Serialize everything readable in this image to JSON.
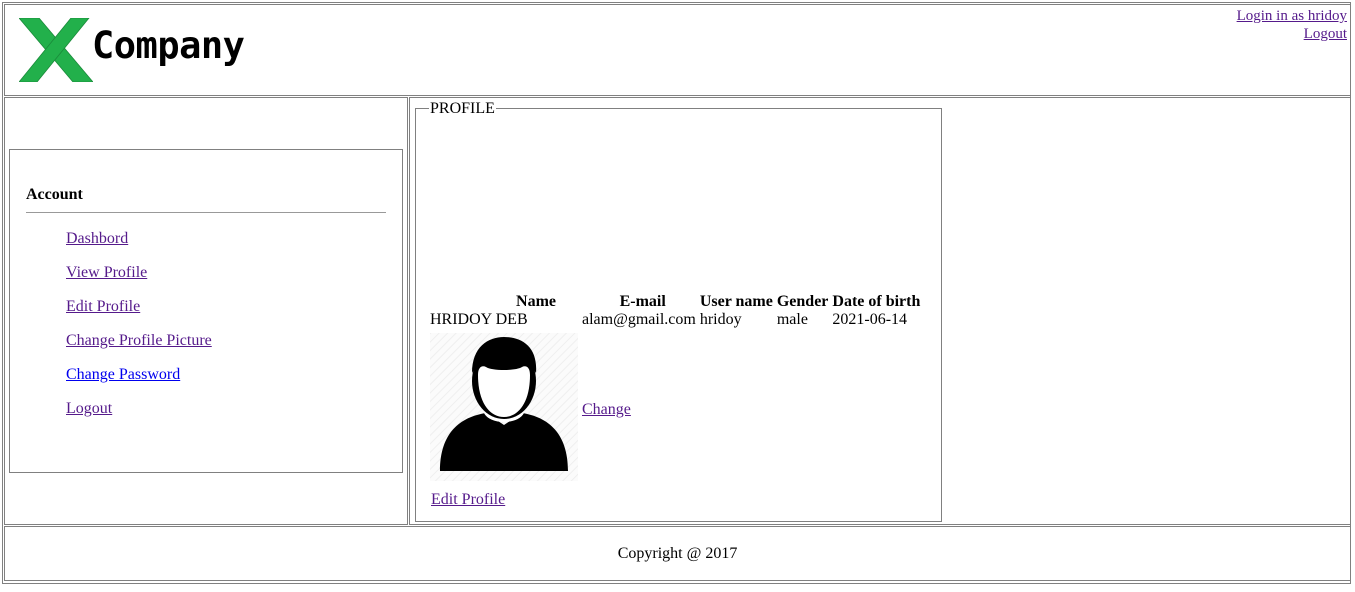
{
  "header": {
    "brand": "Company",
    "logo_icon": "x-logo-icon",
    "logo_color": "#22b04b",
    "login_status": "Login in as hridoy",
    "logout": "Logout"
  },
  "sidebar": {
    "title": "Account",
    "items": [
      {
        "label": "Dashbord"
      },
      {
        "label": "View Profile"
      },
      {
        "label": "Edit Profile"
      },
      {
        "label": "Change Profile Picture"
      },
      {
        "label": "Change Password"
      },
      {
        "label": "Logout"
      }
    ]
  },
  "profile": {
    "legend": "PROFILE",
    "columns": [
      "Name",
      "E-mail",
      "User name",
      "Gender",
      "Date of birth"
    ],
    "row": [
      "HRIDOY DEB",
      "alam@gmail.com",
      "hridoy",
      "male",
      "2021-06-14"
    ],
    "avatar_icon": "user-avatar-icon",
    "change": "Change",
    "edit": "Edit Profile"
  },
  "footer": {
    "copyright": "Copyright @ 2017"
  }
}
